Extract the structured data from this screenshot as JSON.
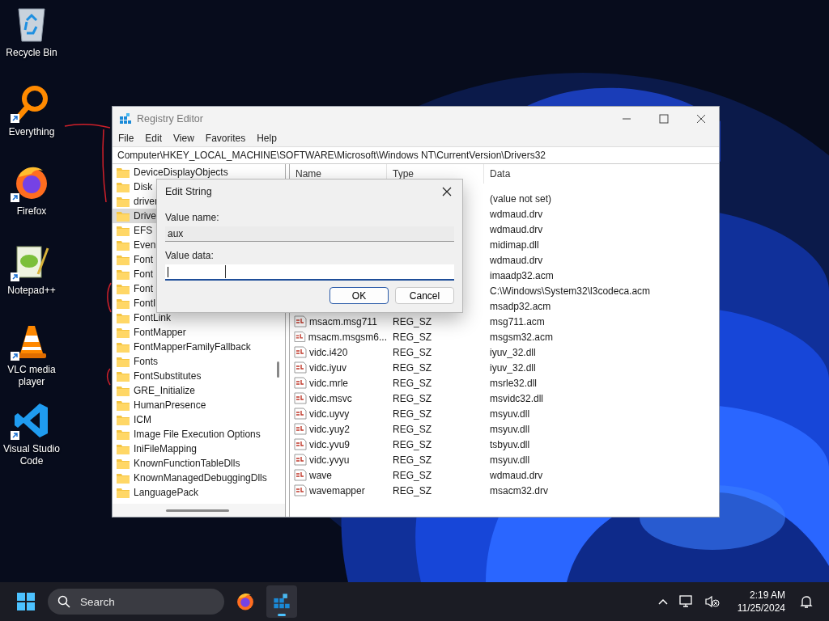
{
  "desktop_icons": [
    {
      "label": "Recycle Bin",
      "kind": "bin",
      "shortcut": false
    },
    {
      "label": "Everything",
      "kind": "magnifier",
      "shortcut": true
    },
    {
      "label": "Firefox",
      "kind": "browser",
      "shortcut": true
    },
    {
      "label": "Notepad++",
      "kind": "notepad",
      "shortcut": true
    },
    {
      "label": "VLC media player",
      "kind": "cone",
      "shortcut": true
    },
    {
      "label": "Visual Studio Code",
      "kind": "code",
      "shortcut": true
    }
  ],
  "registry": {
    "title": "Registry Editor",
    "menu": [
      "File",
      "Edit",
      "View",
      "Favorites",
      "Help"
    ],
    "address": "Computer\\HKEY_LOCAL_MACHINE\\SOFTWARE\\Microsoft\\Windows NT\\CurrentVersion\\Drivers32",
    "tree": [
      {
        "label": "DeviceDisplayObjects",
        "selected": false
      },
      {
        "label": "Disk",
        "selected": false
      },
      {
        "label": "driver",
        "selected": false
      },
      {
        "label": "Drive",
        "selected": true
      },
      {
        "label": "EFS",
        "selected": false
      },
      {
        "label": "Even",
        "selected": false
      },
      {
        "label": "Font",
        "selected": false
      },
      {
        "label": "Font",
        "selected": false
      },
      {
        "label": "Font",
        "selected": false
      },
      {
        "label": "FontI",
        "selected": false
      },
      {
        "label": "FontLink",
        "selected": false
      },
      {
        "label": "FontMapper",
        "selected": false
      },
      {
        "label": "FontMapperFamilyFallback",
        "selected": false
      },
      {
        "label": "Fonts",
        "selected": false
      },
      {
        "label": "FontSubstitutes",
        "selected": false
      },
      {
        "label": "GRE_Initialize",
        "selected": false
      },
      {
        "label": "HumanPresence",
        "selected": false
      },
      {
        "label": "ICM",
        "selected": false
      },
      {
        "label": "Image File Execution Options",
        "selected": false
      },
      {
        "label": "IniFileMapping",
        "selected": false
      },
      {
        "label": "KnownFunctionTableDlls",
        "selected": false
      },
      {
        "label": "KnownManagedDebuggingDlls",
        "selected": false
      },
      {
        "label": "LanguagePack",
        "selected": false
      }
    ],
    "columns": [
      "Name",
      "Type",
      "Data"
    ],
    "rows": [
      {
        "data": "(value not set)"
      },
      {
        "data": "wdmaud.drv"
      },
      {
        "data": "wdmaud.drv"
      },
      {
        "data": "midimap.dll"
      },
      {
        "data": "wdmaud.drv"
      },
      {
        "data": "imaadp32.acm"
      },
      {
        "data": "C:\\Windows\\System32\\l3codeca.acm"
      },
      {
        "data": "msadp32.acm"
      },
      {
        "name": "msacm.msg711",
        "type": "REG_SZ",
        "data": "msg711.acm"
      },
      {
        "name": "msacm.msgsm6...",
        "type": "REG_SZ",
        "data": "msgsm32.acm"
      },
      {
        "name": "vidc.i420",
        "type": "REG_SZ",
        "data": "iyuv_32.dll"
      },
      {
        "name": "vidc.iyuv",
        "type": "REG_SZ",
        "data": "iyuv_32.dll"
      },
      {
        "name": "vidc.mrle",
        "type": "REG_SZ",
        "data": "msrle32.dll"
      },
      {
        "name": "vidc.msvc",
        "type": "REG_SZ",
        "data": "msvidc32.dll"
      },
      {
        "name": "vidc.uyvy",
        "type": "REG_SZ",
        "data": "msyuv.dll"
      },
      {
        "name": "vidc.yuy2",
        "type": "REG_SZ",
        "data": "msyuv.dll"
      },
      {
        "name": "vidc.yvu9",
        "type": "REG_SZ",
        "data": "tsbyuv.dll"
      },
      {
        "name": "vidc.yvyu",
        "type": "REG_SZ",
        "data": "msyuv.dll"
      },
      {
        "name": "wave",
        "type": "REG_SZ",
        "data": "wdmaud.drv"
      },
      {
        "name": "wavemapper",
        "type": "REG_SZ",
        "data": "msacm32.drv"
      }
    ]
  },
  "dialog": {
    "title": "Edit String",
    "value_name_label": "Value name:",
    "value_name": "aux",
    "value_data_label": "Value data:",
    "buttons": [
      {
        "label": "OK",
        "default": true
      },
      {
        "label": "Cancel",
        "default": false
      }
    ]
  },
  "taskbar": {
    "search_placeholder": "Search",
    "apps": [
      {
        "kind": "browser",
        "active": false
      },
      {
        "kind": "registry",
        "active": true
      }
    ],
    "time": "2:19 AM",
    "date": "11/25/2024"
  }
}
